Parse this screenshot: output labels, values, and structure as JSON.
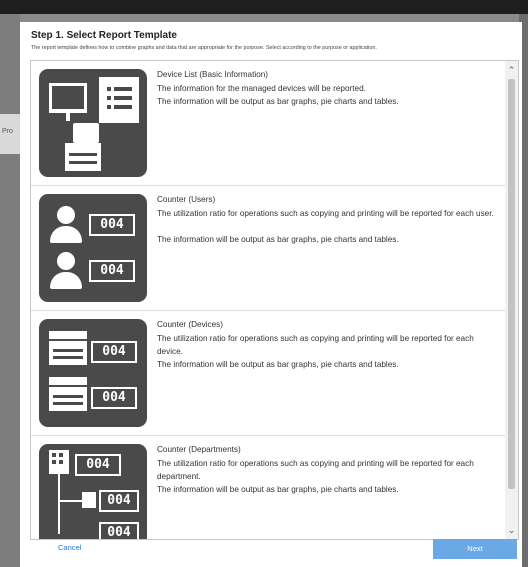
{
  "background": {
    "side_tab_label": "Pro"
  },
  "dialog": {
    "title": "Step 1. Select Report Template",
    "description": "The report template defines how to combine graphs and data that are appropriate for the purpose. Select according to the purpose or application."
  },
  "templates": [
    {
      "name": "Device List (Basic Information)",
      "lines": [
        "The information for the managed devices will be reported.",
        "The information will be output as bar graphs, pie charts and tables."
      ],
      "icon": "device-list-icon"
    },
    {
      "name": "Counter (Users)",
      "lines": [
        "The utilization ratio for operations such as copying and printing will be reported for each user.",
        "The information will be output as bar graphs, pie charts and tables."
      ],
      "icon": "counter-users-icon",
      "counter_text": "004"
    },
    {
      "name": "Counter (Devices)",
      "lines": [
        "The utilization ratio for operations such as copying and printing will be reported for each device.",
        "The information will be output as bar graphs, pie charts and tables."
      ],
      "icon": "counter-devices-icon",
      "counter_text": "004"
    },
    {
      "name": "Counter (Departments)",
      "lines": [
        "The utilization ratio for operations such as copying and printing will be reported for each department.",
        "The information will be output as bar graphs, pie charts and tables."
      ],
      "icon": "counter-departments-icon",
      "counter_text": "004"
    }
  ],
  "buttons": {
    "cancel": "Cancel",
    "next": "Next"
  },
  "colors": {
    "accent": "#6aa9e6",
    "link": "#2b78c5",
    "icon_bg": "#4a4a4a"
  }
}
